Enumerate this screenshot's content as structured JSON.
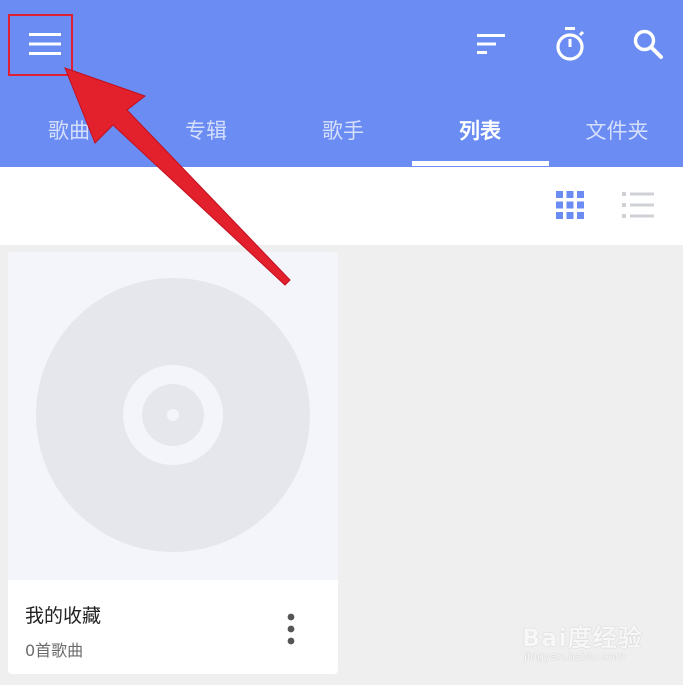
{
  "colors": {
    "appbar": "#6a8cf3",
    "accent": "#6a8cf3",
    "annotation": "#e3212d"
  },
  "appbar": {
    "menu_icon": "menu-icon",
    "sort_icon": "sort-icon",
    "timer_icon": "timer-icon",
    "search_icon": "search-icon"
  },
  "tabs": [
    {
      "label": "歌曲",
      "active": false
    },
    {
      "label": "专辑",
      "active": false
    },
    {
      "label": "歌手",
      "active": false
    },
    {
      "label": "列表",
      "active": true
    },
    {
      "label": "文件夹",
      "active": false
    }
  ],
  "view_toggle": {
    "grid_icon": "grid-view-icon",
    "list_icon": "list-view-icon",
    "selected": "grid"
  },
  "playlists": [
    {
      "title": "我的收藏",
      "subtitle": "0首歌曲",
      "cover_icon": "disc-icon",
      "menu_icon": "more-vert-icon"
    }
  ],
  "watermark": {
    "brand": "Bai度经验",
    "url": "jingyan.baidu.com"
  }
}
